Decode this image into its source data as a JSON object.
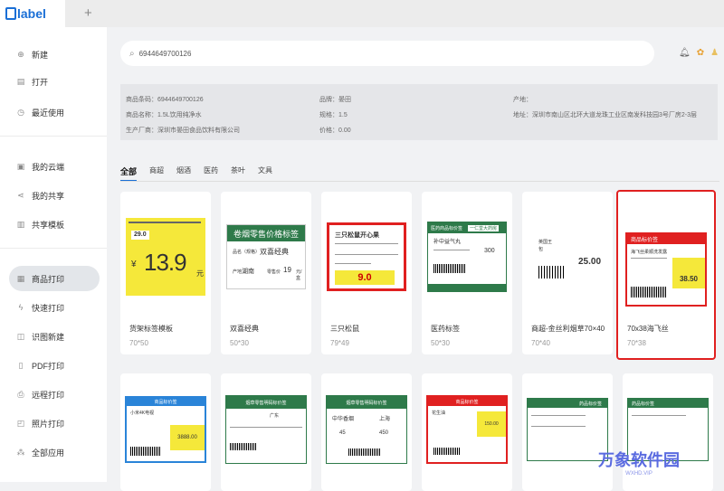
{
  "app": {
    "logo": "label",
    "new_tab": "+"
  },
  "sidebar": {
    "items": [
      {
        "label": "新建",
        "icon": "new-file-icon"
      },
      {
        "label": "打开",
        "icon": "open-folder-icon"
      },
      {
        "label": "最近使用",
        "icon": "clock-icon"
      },
      {
        "label": "我的云端",
        "icon": "cloud-icon"
      },
      {
        "label": "我的共享",
        "icon": "share-icon"
      },
      {
        "label": "共享模板",
        "icon": "template-icon"
      },
      {
        "label": "商品打印",
        "icon": "product-print-icon"
      },
      {
        "label": "快速打印",
        "icon": "quick-print-icon"
      },
      {
        "label": "识图新建",
        "icon": "image-recognize-icon"
      },
      {
        "label": "PDF打印",
        "icon": "pdf-icon"
      },
      {
        "label": "远程打印",
        "icon": "remote-print-icon"
      },
      {
        "label": "照片打印",
        "icon": "photo-print-icon"
      },
      {
        "label": "全部应用",
        "icon": "apps-icon"
      }
    ]
  },
  "search": {
    "value": "6944649700126"
  },
  "product": {
    "barcode": "商品条码：6944649700126",
    "name": "商品名称：1.5L饮用纯净水",
    "maker": "生产厂商：深圳市晏田食品饮料有限公司",
    "brand": "品牌：晏田",
    "spec": "规格：1.5",
    "price": "价格：0.00",
    "origin": "产地：",
    "address": "地址：深圳市南山区北环大道龙珠工业区南发科技园3号厂房2-3层"
  },
  "categories": [
    "全部",
    "商超",
    "烟酒",
    "医药",
    "茶叶",
    "文具"
  ],
  "templates": [
    {
      "name": "货架标签模板",
      "size": "70*50",
      "big": "13.9",
      "unit": "元",
      "small": "29.0"
    },
    {
      "name": "双喜经典",
      "size": "50*30",
      "title": "卷烟零售价格标签",
      "product": "双喜经典",
      "origin": "湖南",
      "price": "19"
    },
    {
      "name": "三只松鼠",
      "size": "79*49",
      "title": "三只松鼠开心果",
      "price": "9.0"
    },
    {
      "name": "医药标签",
      "size": "50*30",
      "title": "医药商品标价签",
      "store": "一仁堂大药房",
      "product": "补中益气丸",
      "price": "300"
    },
    {
      "name": "商超-金丝利烟草70×40",
      "size": "70*40",
      "price": "25.00",
      "text1": "英国王",
      "text2": "包"
    },
    {
      "name": "70x38海飞丝",
      "size": "70*38",
      "title": "商品标价签",
      "product": "海飞丝柔顺洗发露",
      "price": "38.50"
    }
  ],
  "templates_row2": [
    {
      "title": "商品标价签",
      "product": "小米4K电视",
      "price": "3888.00"
    },
    {
      "title": "烟草零售明码标价签",
      "origin": "广东"
    },
    {
      "title": "烟草零售明码标价签",
      "product": "中华香烟",
      "origin": "上海",
      "p1": "45",
      "p2": "450"
    },
    {
      "title": "商品标价签",
      "product": "花生油",
      "price": "150.00"
    },
    {
      "title": "药品标价签",
      "product": ""
    },
    {
      "title": "药品标价签",
      "product": ""
    }
  ],
  "watermark": {
    "text": "万象软件园",
    "url": "WXHD.VIP"
  }
}
